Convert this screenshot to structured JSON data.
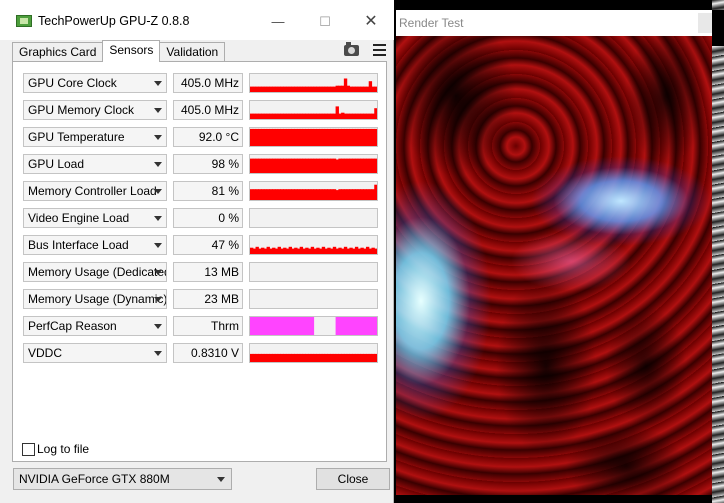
{
  "gpuz": {
    "title": "TechPowerUp GPU-Z 0.8.8",
    "window_buttons": {
      "minimize": "—",
      "maximize": "☐",
      "close": "✕"
    },
    "tabs": [
      {
        "label": "Graphics Card"
      },
      {
        "label": "Sensors",
        "active": true
      },
      {
        "label": "Validation"
      }
    ],
    "sensors": [
      {
        "label": "GPU Core Clock",
        "value": "405.0 MHz",
        "graph_color": "#ff0000",
        "graph": [
          0.3,
          0.3,
          0.3,
          0.3,
          0.3,
          0.3,
          0.3,
          0.3,
          0.3,
          0.3,
          0.3,
          0.3,
          0.3,
          0.3,
          0.3,
          0.3,
          0.3,
          0.3,
          0.3,
          0.3,
          0.3,
          0.3,
          0.3,
          0.3,
          0.3,
          0.3,
          0.3,
          0.3,
          0.3,
          0.3,
          0.3,
          0.35,
          0.35,
          0.35,
          0.75,
          0.35,
          0.3,
          0.3,
          0.3,
          0.3,
          0.3,
          0.3,
          0.3,
          0.6,
          0.3,
          0.3
        ]
      },
      {
        "label": "GPU Memory Clock",
        "value": "405.0 MHz",
        "graph_color": "#ff0000",
        "graph": [
          0.3,
          0.3,
          0.3,
          0.3,
          0.3,
          0.3,
          0.3,
          0.3,
          0.3,
          0.3,
          0.3,
          0.3,
          0.3,
          0.3,
          0.3,
          0.3,
          0.3,
          0.3,
          0.3,
          0.3,
          0.3,
          0.3,
          0.3,
          0.3,
          0.3,
          0.3,
          0.3,
          0.3,
          0.3,
          0.3,
          0.3,
          0.7,
          0.3,
          0.35,
          0.3,
          0.3,
          0.3,
          0.3,
          0.3,
          0.3,
          0.3,
          0.3,
          0.3,
          0.3,
          0.3,
          0.6
        ]
      },
      {
        "label": "GPU Temperature",
        "value": "92.0 °C",
        "graph_color": "#ff0000",
        "graph": [
          0.95,
          0.95,
          0.95,
          0.95,
          0.95,
          0.95,
          0.95,
          0.95,
          0.95,
          0.95,
          0.95,
          0.95,
          0.95,
          0.95,
          0.95,
          0.95,
          0.95,
          0.95,
          0.95,
          0.95,
          0.95,
          0.95,
          0.95,
          0.95,
          0.95,
          0.95,
          0.95,
          0.95,
          0.95,
          0.95,
          0.95,
          0.95,
          0.95,
          0.95,
          0.95,
          0.95,
          0.95,
          0.95,
          0.95,
          0.95,
          0.95,
          0.95,
          0.95,
          0.95,
          0.95,
          0.95
        ]
      },
      {
        "label": "GPU Load",
        "value": "98 %",
        "graph_color": "#ff0000",
        "graph": [
          0.8,
          0.8,
          0.8,
          0.8,
          0.8,
          0.8,
          0.8,
          0.8,
          0.8,
          0.8,
          0.8,
          0.8,
          0.8,
          0.8,
          0.8,
          0.8,
          0.8,
          0.8,
          0.8,
          0.8,
          0.8,
          0.8,
          0.8,
          0.8,
          0.8,
          0.8,
          0.8,
          0.8,
          0.8,
          0.8,
          0.8,
          0.75,
          0.8,
          0.8,
          0.8,
          0.8,
          0.8,
          0.8,
          0.8,
          0.8,
          0.8,
          0.8,
          0.8,
          0.8,
          0.8,
          0.8
        ]
      },
      {
        "label": "Memory Controller Load",
        "value": "81 %",
        "graph_color": "#ff0000",
        "graph": [
          0.6,
          0.6,
          0.6,
          0.6,
          0.6,
          0.6,
          0.6,
          0.6,
          0.6,
          0.6,
          0.6,
          0.6,
          0.6,
          0.6,
          0.6,
          0.6,
          0.6,
          0.6,
          0.6,
          0.6,
          0.6,
          0.6,
          0.6,
          0.6,
          0.6,
          0.6,
          0.6,
          0.6,
          0.6,
          0.6,
          0.6,
          0.55,
          0.6,
          0.6,
          0.6,
          0.6,
          0.6,
          0.6,
          0.6,
          0.6,
          0.6,
          0.6,
          0.6,
          0.6,
          0.6,
          0.85
        ]
      },
      {
        "label": "Video Engine Load",
        "value": "0 %",
        "graph_color": "#ff0000",
        "graph": []
      },
      {
        "label": "Bus Interface Load",
        "value": "47 %",
        "graph_color": "#ff0000",
        "graph": [
          0.35,
          0.3,
          0.4,
          0.3,
          0.35,
          0.3,
          0.4,
          0.3,
          0.35,
          0.3,
          0.4,
          0.3,
          0.35,
          0.3,
          0.4,
          0.3,
          0.35,
          0.3,
          0.4,
          0.3,
          0.35,
          0.3,
          0.4,
          0.3,
          0.35,
          0.3,
          0.4,
          0.3,
          0.35,
          0.3,
          0.4,
          0.3,
          0.35,
          0.3,
          0.4,
          0.3,
          0.35,
          0.3,
          0.4,
          0.3,
          0.35,
          0.3,
          0.4,
          0.3,
          0.35,
          0.3
        ]
      },
      {
        "label": "Memory Usage (Dedicated)",
        "value": "13 MB",
        "graph_color": "#ff0000",
        "graph": []
      },
      {
        "label": "Memory Usage (Dynamic)",
        "value": "23 MB",
        "graph_color": "#ff0000",
        "graph": []
      },
      {
        "label": "PerfCap Reason",
        "value": "Thrm",
        "graph_color": "#ff44ff",
        "graph": [
          1,
          1,
          1,
          1,
          1,
          1,
          1,
          1,
          1,
          1,
          1,
          1,
          1,
          1,
          1,
          1,
          1,
          1,
          1,
          1,
          1,
          1,
          1,
          0,
          0,
          0,
          0,
          0,
          0,
          0,
          0,
          1,
          1,
          1,
          1,
          1,
          1,
          1,
          1,
          1,
          1,
          1,
          1,
          1,
          1,
          1
        ]
      },
      {
        "label": "VDDC",
        "value": "0.8310 V",
        "graph_color": "#ff0000",
        "graph": [
          0.45,
          0.45,
          0.45,
          0.45,
          0.45,
          0.45,
          0.45,
          0.45,
          0.45,
          0.45,
          0.45,
          0.45,
          0.45,
          0.45,
          0.45,
          0.45,
          0.45,
          0.45,
          0.45,
          0.45,
          0.45,
          0.45,
          0.45,
          0.45,
          0.45,
          0.45,
          0.45,
          0.45,
          0.45,
          0.45,
          0.45,
          0.45,
          0.45,
          0.45,
          0.45,
          0.45,
          0.45,
          0.45,
          0.45,
          0.45,
          0.45,
          0.45,
          0.45,
          0.45,
          0.45,
          0.45
        ]
      }
    ],
    "log_to_file": {
      "label": "Log to file",
      "checked": false
    },
    "gpu_select": {
      "value": "NVIDIA GeForce GTX 880M"
    },
    "close_label": "Close"
  },
  "render_test": {
    "title": "Render Test"
  }
}
